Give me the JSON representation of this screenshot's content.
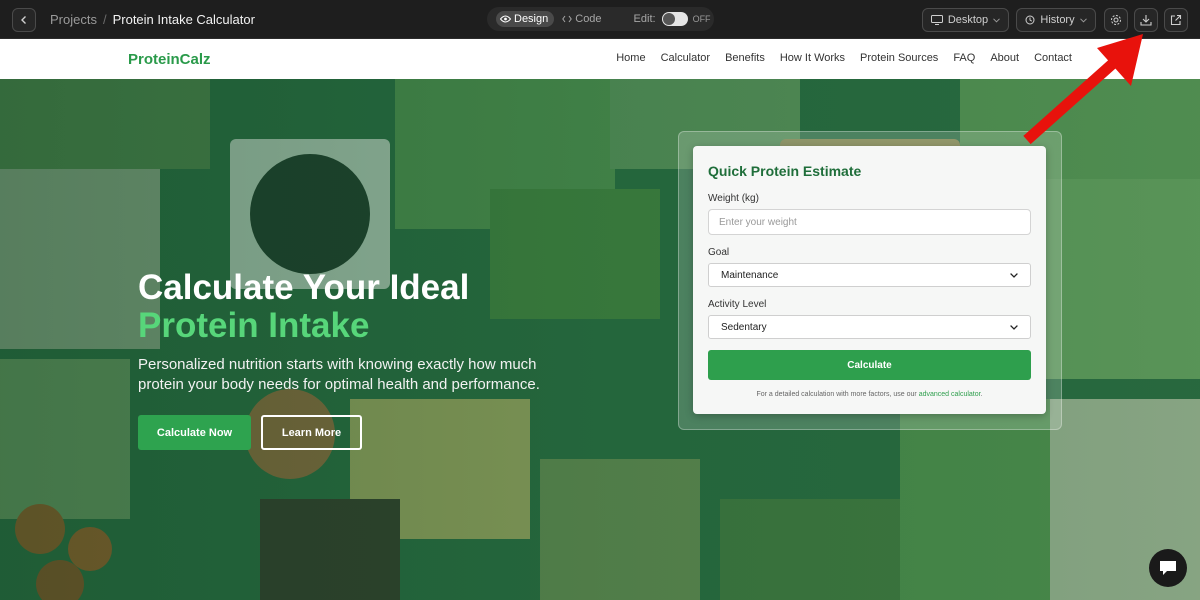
{
  "editor": {
    "breadcrumb_root": "Projects",
    "breadcrumb_sep": "/",
    "breadcrumb_current": "Protein Intake Calculator",
    "mode_design": "Design",
    "mode_code": "Code",
    "edit_label": "Edit:",
    "edit_state": "OFF",
    "viewport_label": "Desktop",
    "history_label": "History",
    "icons": [
      "chevron-left-icon",
      "eye-icon",
      "code-icon",
      "monitor-icon",
      "history-icon",
      "gear-icon",
      "download-icon",
      "external-link-icon"
    ]
  },
  "site": {
    "logo": "ProteinCalz",
    "nav": [
      "Home",
      "Calculator",
      "Benefits",
      "How It Works",
      "Protein Sources",
      "FAQ",
      "About",
      "Contact"
    ]
  },
  "hero": {
    "title_line1": "Calculate Your Ideal",
    "title_line2": "Protein Intake",
    "subtitle": "Personalized nutrition starts with knowing exactly how much protein your body needs for optimal health and performance.",
    "primary_button": "Calculate Now",
    "secondary_button": "Learn More"
  },
  "card": {
    "title": "Quick Protein Estimate",
    "weight_label": "Weight (kg)",
    "weight_placeholder": "Enter your weight",
    "goal_label": "Goal",
    "goal_value": "Maintenance",
    "activity_label": "Activity Level",
    "activity_value": "Sedentary",
    "button": "Calculate",
    "note_prefix": "For a detailed calculation with more factors, use our",
    "note_link": "advanced calculator",
    "note_suffix": "."
  },
  "colors": {
    "brand_green": "#2a9a4a",
    "accent_light_green": "#57d67a",
    "annotation_red": "#e8120c"
  }
}
